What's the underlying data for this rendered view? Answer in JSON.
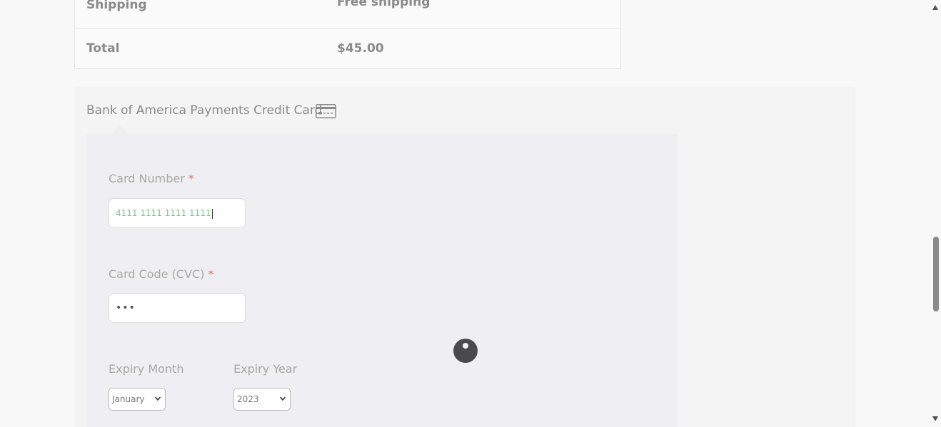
{
  "order_totals": {
    "shipping_label": "Shipping",
    "shipping_value": "Free shipping",
    "total_label": "Total",
    "total_value": "$45.00"
  },
  "payment": {
    "method_label": "Bank of America Payments Credit Card",
    "method_icon": "credit-card-icon",
    "card_number": {
      "label": "Card Number",
      "required_mark": "*",
      "value": "4111 1111 1111 1111"
    },
    "card_code": {
      "label": "Card Code (CVC)",
      "required_mark": "*",
      "value": "•••"
    },
    "expiry_month": {
      "label": "Expiry Month",
      "selected": "January"
    },
    "expiry_year": {
      "label": "Expiry Year",
      "selected": "2023"
    }
  },
  "colors": {
    "card_number_text": "#7cc47a",
    "required_star": "#e0706a",
    "spinner": "#4a4a4e"
  }
}
